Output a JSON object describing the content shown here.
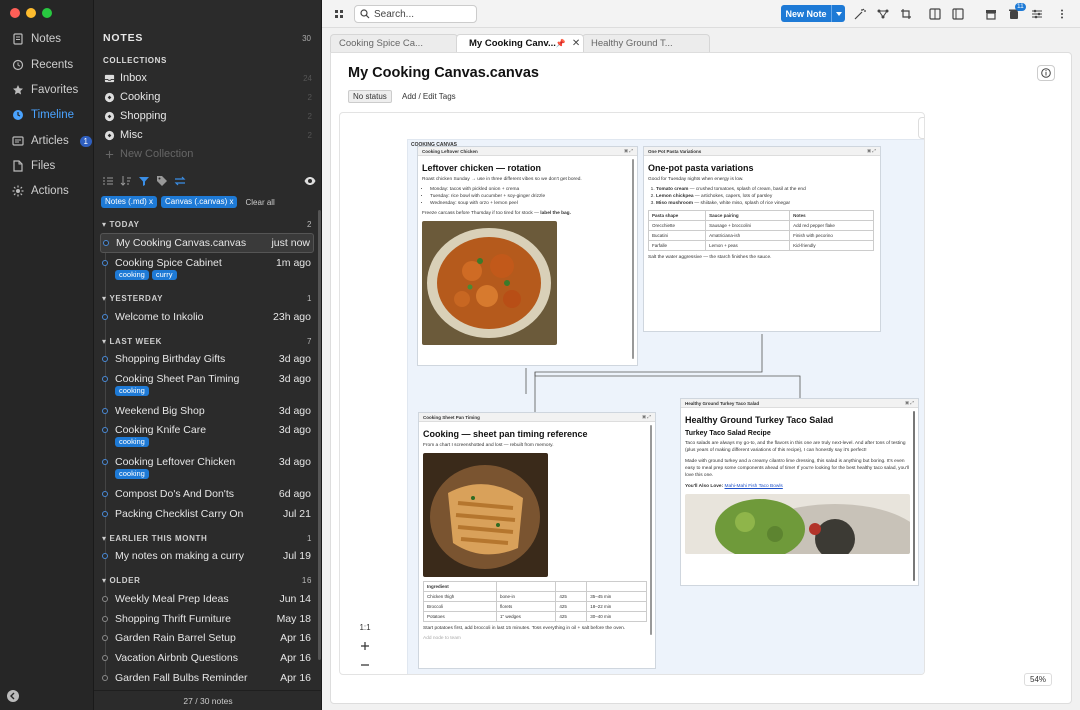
{
  "nav": {
    "items": [
      {
        "label": "Notes",
        "icon": "notes-icon",
        "active": false
      },
      {
        "label": "Recents",
        "icon": "recents-icon",
        "active": false
      },
      {
        "label": "Favorites",
        "icon": "star-icon",
        "active": false
      },
      {
        "label": "Timeline",
        "icon": "timeline-icon",
        "active": true
      },
      {
        "label": "Articles",
        "icon": "articles-icon",
        "badge": "1",
        "active": false
      },
      {
        "label": "Files",
        "icon": "files-icon",
        "active": false
      },
      {
        "label": "Actions",
        "icon": "actions-icon",
        "active": false
      }
    ]
  },
  "list": {
    "title": "NOTES",
    "total": "30",
    "collections_header": "COLLECTIONS",
    "collections": [
      {
        "label": "Inbox",
        "count": "24"
      },
      {
        "label": "Cooking",
        "count": "2"
      },
      {
        "label": "Shopping",
        "count": "2"
      },
      {
        "label": "Misc",
        "count": "2"
      }
    ],
    "new_collection": "New Collection",
    "filter_chips": [
      "Notes (.md) x",
      "Canvas (.canvas) x"
    ],
    "clear_all": "Clear all",
    "sections": [
      {
        "label": "TODAY",
        "count": "2"
      },
      {
        "label": "YESTERDAY",
        "count": "1"
      },
      {
        "label": "LAST WEEK",
        "count": "7"
      },
      {
        "label": "EARLIER THIS MONTH",
        "count": "1"
      },
      {
        "label": "OLDER",
        "count": "16"
      }
    ],
    "notes": [
      {
        "title": "My Cooking Canvas.canvas",
        "date": "just now"
      },
      {
        "title": "Cooking Spice Cabinet",
        "date": "1m ago",
        "tags": [
          "cooking",
          "curry"
        ]
      },
      {
        "title": "Welcome to Inkolio",
        "date": "23h ago"
      },
      {
        "title": "Shopping Birthday Gifts",
        "date": "3d ago"
      },
      {
        "title": "Cooking Sheet Pan Timing",
        "date": "3d ago",
        "tags": [
          "cooking"
        ]
      },
      {
        "title": "Weekend Big Shop",
        "date": "3d ago"
      },
      {
        "title": "Cooking Knife Care",
        "date": "3d ago",
        "tags": [
          "cooking"
        ]
      },
      {
        "title": "Cooking Leftover Chicken",
        "date": "3d ago",
        "tags": [
          "cooking"
        ]
      },
      {
        "title": "Compost Do's And Don'ts",
        "date": "6d ago"
      },
      {
        "title": "Packing Checklist Carry On",
        "date": "Jul 21"
      },
      {
        "title": "My notes on making a curry",
        "date": "Jul 19"
      },
      {
        "title": "Weekly Meal Prep Ideas",
        "date": "Jun 14"
      },
      {
        "title": "Shopping Thrift Furniture",
        "date": "May 18"
      },
      {
        "title": "Garden Rain Barrel Setup",
        "date": "Apr 16"
      },
      {
        "title": "Vacation Airbnb Questions",
        "date": "Apr 16"
      },
      {
        "title": "Garden Fall Bulbs Reminder",
        "date": "Apr 16"
      }
    ],
    "footer": "27 / 30 notes"
  },
  "toolbar": {
    "search_placeholder": "Search...",
    "new_note": "New Note",
    "badge": "11"
  },
  "tabs": [
    {
      "label": "Cooking Spice Ca..."
    },
    {
      "label": "My Cooking Canv...",
      "active": true
    },
    {
      "label": "Healthy Ground T..."
    }
  ],
  "doc": {
    "title": "My Cooking Canvas.canvas",
    "status": "No status",
    "tags": "Add / Edit Tags",
    "zoom": "54%",
    "zoom_reset": "1:1"
  },
  "canvas": {
    "group_label": "COOKING CANVAS",
    "leftover": {
      "header": "Cooking Leftover Chicken",
      "title": "Leftover chicken — rotation",
      "intro": "Roast chicken Sunday → use in three different vibes so we don't get bored.",
      "items": [
        "Monday: tacos with pickled onion + crema",
        "Tuesday: rice bowl with cucumber + soy-ginger drizzle",
        "Wednesday: soup with orzo + lemon peel"
      ],
      "outro_start": "Freeze carcass before Thursday if too tired for stock — ",
      "outro_bold": "label the bag."
    },
    "pasta": {
      "header": "One Pot Pasta Variations",
      "title": "One-pot pasta variations",
      "intro": "Good for Tuesday nights when energy is low.",
      "items": [
        {
          "bold": "Tomato cream",
          "rest": " — crushed tomatoes, splash of cream, basil at the end"
        },
        {
          "bold": "Lemon chickpea",
          "rest": " — artichokes, capers, lots of parsley"
        },
        {
          "bold": "Miso mushroom",
          "rest": " — shiitake, white miso, splash of rice vinegar"
        }
      ],
      "table_headers": [
        "Pasta shape",
        "Sauce pairing",
        "Notes"
      ],
      "table_rows": [
        [
          "Orecchiette",
          "Sausage + broccolini",
          "Add red pepper flake"
        ],
        [
          "Bucatini",
          "Amatriciana-ish",
          "Finish with pecorino"
        ],
        [
          "Farfalle",
          "Lemon + peas",
          "Kid-friendly"
        ]
      ],
      "outro": "Salt the water aggressive — the starch finishes the sauce."
    },
    "sheetpan": {
      "header": "Cooking Sheet Pan Timing",
      "title": "Cooking — sheet pan timing reference",
      "intro": "From a chart I screenshotted and lost — rebuilt from memory.",
      "table_headers": [
        "Ingredient",
        "",
        "",
        ""
      ],
      "table_rows": [
        [
          "Chicken thigh",
          "bone-in",
          "425",
          "35–45 min"
        ],
        [
          "Broccoli",
          "florets",
          "425",
          "18–22 min"
        ],
        [
          "Potatoes",
          "1\" wedges",
          "425",
          "30–40 min"
        ]
      ],
      "outro": "Start potatoes first, add broccoli in last 15 minutes. Toss everything in oil + salt before the oven.",
      "hint": "Add node to team"
    },
    "taco": {
      "header": "Healthy Ground Turkey Taco Salad",
      "title": "Healthy Ground Turkey Taco Salad",
      "subtitle": "Turkey Taco Salad Recipe",
      "p1": "Taco salads are always my go-to, and the flavors in this one are truly next-level. And after tons of testing (plus years of making different variations of this recipe), I can honestly say it's perfect!",
      "p2": "Made with ground turkey and a creamy cilantro lime dressing, this salad is anything but boring. It's even easy to meal prep some components ahead of time! If you're looking for the best healthy taco salad, you'll love this one.",
      "also_label": "You'll Also Love: ",
      "also_link": "Mahi-Mahi Fish Taco Bowls"
    }
  }
}
